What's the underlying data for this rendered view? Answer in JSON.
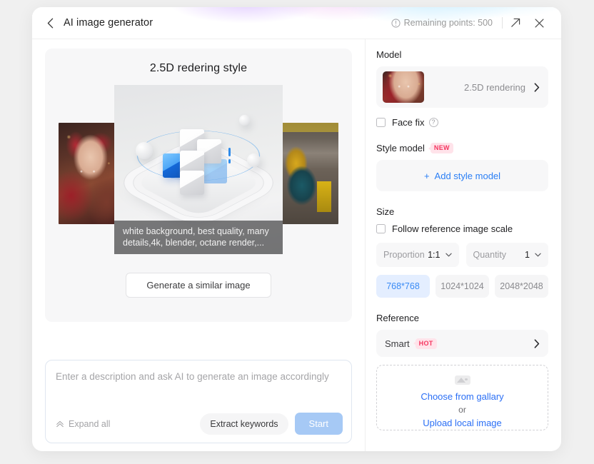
{
  "header": {
    "back_icon": "chevron-left-icon",
    "title": "AI image generator",
    "points_icon": "info-circle-icon",
    "points_text": "Remaining points: 500",
    "expand_icon": "expand-arrow-icon",
    "close_icon": "close-icon"
  },
  "left": {
    "preview_title": "2.5D redering style",
    "caption": "white background, best quality, many details,4k, blender, octane render,...",
    "generate_similar_label": "Generate a similar image",
    "prompt": {
      "value": "",
      "placeholder": "Enter a description and ask AI to generate an image accordingly",
      "expand_all_label": "Expand all",
      "expand_all_icon": "double-chevron-up-icon",
      "extract_keywords_label": "Extract keywords",
      "start_label": "Start"
    }
  },
  "right": {
    "model": {
      "section_title": "Model",
      "selected_name": "2.5D rendering",
      "chevron_icon": "chevron-right-icon",
      "face_fix_label": "Face fix",
      "face_fix_checked": false,
      "face_fix_help_icon": "question-circle-icon"
    },
    "style_model": {
      "section_title": "Style model",
      "badge": "NEW",
      "add_label": "Add style model",
      "add_icon": "plus-icon"
    },
    "size": {
      "section_title": "Size",
      "follow_label": "Follow reference image scale",
      "follow_checked": false,
      "proportion_label": "Proportion",
      "proportion_value": "1:1",
      "quantity_label": "Quantity",
      "quantity_value": "1",
      "caret_icon": "chevron-down-icon",
      "resolutions": [
        {
          "label": "768*768",
          "selected": true
        },
        {
          "label": "1024*1024",
          "selected": false
        },
        {
          "label": "2048*2048",
          "selected": false
        }
      ]
    },
    "reference": {
      "section_title": "Reference",
      "smart_label": "Smart",
      "smart_badge": "HOT",
      "chevron_icon": "chevron-right-icon",
      "upload_icon": "image-placeholder-icon",
      "gallery_link": "Choose from gallary",
      "or_text": "or",
      "upload_link": "Upload local image"
    }
  },
  "colors": {
    "accent_blue": "#2b7ff5",
    "selected_chip_bg": "#e4eeff",
    "badge_pink_bg": "#ffe3ea",
    "badge_pink_text": "#f5355f",
    "start_button_bg": "#a6c9f5",
    "panel_gray": "#f7f7f8",
    "page_bg": "#f0f0f0"
  }
}
